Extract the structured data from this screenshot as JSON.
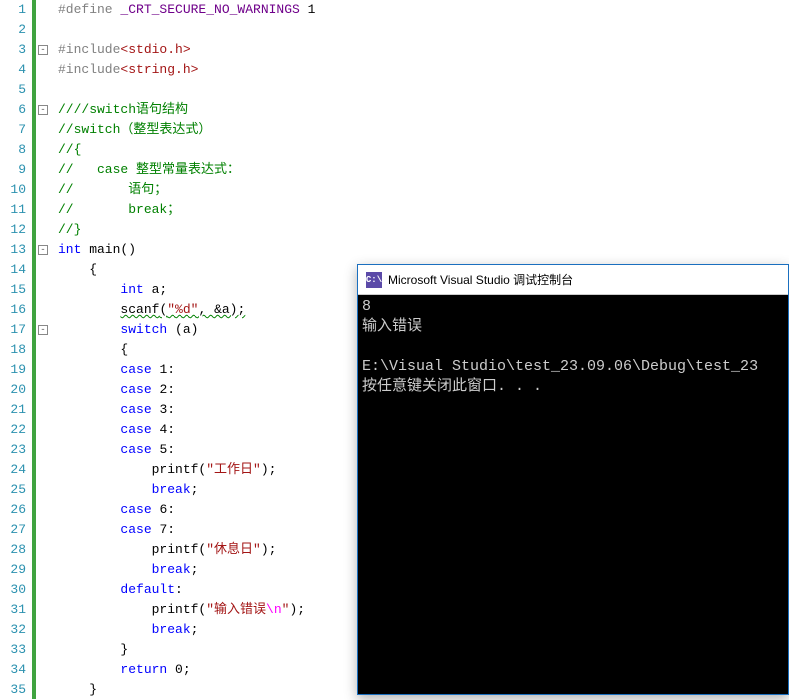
{
  "gutter": {
    "lines": [
      "1",
      "2",
      "3",
      "4",
      "5",
      "6",
      "7",
      "8",
      "9",
      "10",
      "11",
      "12",
      "13",
      "14",
      "15",
      "16",
      "17",
      "18",
      "19",
      "20",
      "21",
      "22",
      "23",
      "24",
      "25",
      "26",
      "27",
      "28",
      "29",
      "30",
      "31",
      "32",
      "33",
      "34",
      "35"
    ]
  },
  "code": {
    "l1_define": "#define",
    "l1_macro": " _CRT_SECURE_NO_WARNINGS",
    "l1_val": " 1",
    "l3_inc": "#include",
    "l3_hdr": "<stdio.h>",
    "l4_inc": "#include",
    "l4_hdr": "<string.h>",
    "l6": "////switch语句结构",
    "l7": "//switch（整型表达式）",
    "l8": "//{",
    "l9": "//   case 整型常量表达式：",
    "l10": "//       语句；",
    "l11": "//       break；",
    "l12": "//}",
    "l13_int": "int",
    "l13_main": " main",
    "l13_p": "()",
    "l14": "    {",
    "l15_pre": "        ",
    "l15_int": "int",
    "l15_rest": " a;",
    "l16_pre": "        ",
    "l16_scanf": "scanf",
    "l16_p1": "(",
    "l16_str": "\"%d\"",
    "l16_rest": ", &a);",
    "l17_pre": "        ",
    "l17_switch": "switch",
    "l17_rest": " (a)",
    "l18": "        {",
    "l19_pre": "        ",
    "l19_case": "case",
    "l19_rest": " 1:",
    "l20_pre": "        ",
    "l20_case": "case",
    "l20_rest": " 2:",
    "l21_pre": "        ",
    "l21_case": "case",
    "l21_rest": " 3:",
    "l22_pre": "        ",
    "l22_case": "case",
    "l22_rest": " 4:",
    "l23_pre": "        ",
    "l23_case": "case",
    "l23_rest": " 5:",
    "l24_pre": "            printf(",
    "l24_str": "\"工作日\"",
    "l24_rest": ");",
    "l25_pre": "            ",
    "l25_break": "break",
    "l25_rest": ";",
    "l26_pre": "        ",
    "l26_case": "case",
    "l26_rest": " 6:",
    "l27_pre": "        ",
    "l27_case": "case",
    "l27_rest": " 7:",
    "l28_pre": "            printf(",
    "l28_str": "\"休息日\"",
    "l28_rest": ");",
    "l29_pre": "            ",
    "l29_break": "break",
    "l29_rest": ";",
    "l30_pre": "        ",
    "l30_default": "default",
    "l30_rest": ":",
    "l31_pre": "            printf(",
    "l31_str1": "\"输入错误",
    "l31_esc": "\\n",
    "l31_str2": "\"",
    "l31_rest": ");",
    "l32_pre": "            ",
    "l32_break": "break",
    "l32_rest": ";",
    "l33": "        }",
    "l34_pre": "        ",
    "l34_return": "return",
    "l34_rest": " 0;",
    "l35": "    }"
  },
  "console": {
    "icon_text": "C:\\",
    "title": "Microsoft Visual Studio 调试控制台",
    "line1": "8",
    "line2": "输入错误",
    "line3": "",
    "line4": "E:\\Visual Studio\\test_23.09.06\\Debug\\test_23",
    "line5": "按任意键关闭此窗口. . ."
  },
  "fold_marks": [
    {
      "line": 3,
      "symbol": "-"
    },
    {
      "line": 6,
      "symbol": "-"
    },
    {
      "line": 13,
      "symbol": "-"
    },
    {
      "line": 17,
      "symbol": "-"
    }
  ]
}
